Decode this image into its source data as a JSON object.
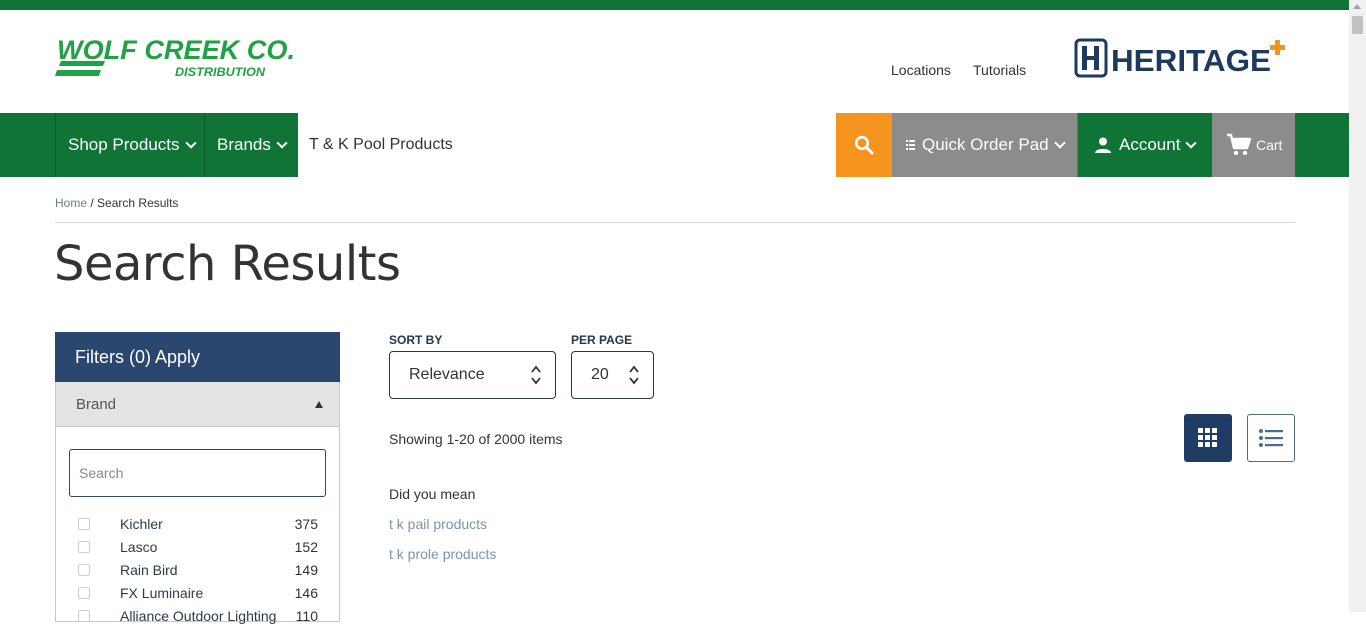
{
  "header": {
    "logo_text": "WOLF CREEK CO.",
    "logo_subtext": "DISTRIBUTION",
    "links": [
      "Locations",
      "Tutorials"
    ],
    "partner_logo_text": "HERITAGE"
  },
  "nav": {
    "shop_products": "Shop Products",
    "brands": "Brands",
    "search_value": "T & K Pool Products",
    "quick_order": "Quick Order Pad",
    "account": "Account",
    "cart": "Cart"
  },
  "breadcrumb": {
    "home": "Home",
    "separator": "/",
    "current": "Search Results"
  },
  "page_title": "Search Results",
  "filters": {
    "header": "Filters (0) Apply",
    "brand_section": "Brand",
    "brand_search_placeholder": "Search",
    "brands": [
      {
        "name": "Kichler",
        "count": "375"
      },
      {
        "name": "Lasco",
        "count": "152"
      },
      {
        "name": "Rain Bird",
        "count": "149"
      },
      {
        "name": "FX Luminaire",
        "count": "146"
      },
      {
        "name": "Alliance Outdoor Lighting",
        "count": "110"
      }
    ]
  },
  "results": {
    "sort_label": "SORT BY",
    "sort_value": "Relevance",
    "per_page_label": "PER PAGE",
    "per_page_value": "20",
    "showing": "Showing 1-20 of 2000 items",
    "did_you_mean": "Did you mean",
    "suggestions": [
      "t k pail products",
      "t k prole products"
    ]
  },
  "colors": {
    "brand_green": "#0f7436",
    "search_orange": "#f7941d",
    "filter_navy": "#29476f",
    "grid_active": "#1f3d64",
    "cart_gray": "#8c8c8c"
  },
  "icons": [
    "search-icon",
    "hamburger-icon",
    "user-icon",
    "cart-icon",
    "grid-view-icon",
    "list-view-icon",
    "chevron-down-icon",
    "caret-up-icon"
  ]
}
